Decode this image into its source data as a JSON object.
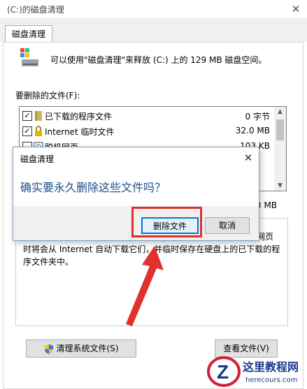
{
  "window": {
    "title": "(C:)的磁盘清理",
    "close_glyph": "✕",
    "tab_label": "磁盘清理"
  },
  "summary_text": "可以使用\"磁盘清理\"来释放  (C:) 上的 129 MB 磁盘空间。",
  "files_to_delete_label": "要删除的文件(F):",
  "file_list": [
    {
      "checked": true,
      "checkmark": "✓",
      "icon": "folder-icon",
      "name": "已下载的程序文件",
      "size": "0 字节"
    },
    {
      "checked": true,
      "checkmark": "✓",
      "icon": "lock-icon",
      "name": "Internet 临时文件",
      "size": "32.0 MB"
    },
    {
      "checked": false,
      "checkmark": "",
      "icon": "offline-page-icon",
      "name": "脱机网页",
      "size": "103 KB"
    }
  ],
  "total_size_text": "3 MB",
  "description_text": "...下载的程序文件包括ActiveX控件和Java小程序。在查看特定网页时将会从 Internet 自动下载它们，并临时保存在硬盘上的已下载的程序文件夹中。",
  "buttons": {
    "cleanup_system_files": "清理系统文件(S)",
    "view_files": "查看文件(V)"
  },
  "confirm_dialog": {
    "title": "磁盘清理",
    "close_glyph": "✕",
    "message": "确实要永久删除这些文件吗？",
    "delete_button": "删除文件",
    "cancel_button": "取消"
  },
  "watermark": {
    "site_name": "这里教程网",
    "site_url": "herecours.com"
  },
  "colors": {
    "highlight_red": "#e0312c",
    "accent_blue": "#0078d7",
    "message_blue": "#1f4e8c"
  }
}
